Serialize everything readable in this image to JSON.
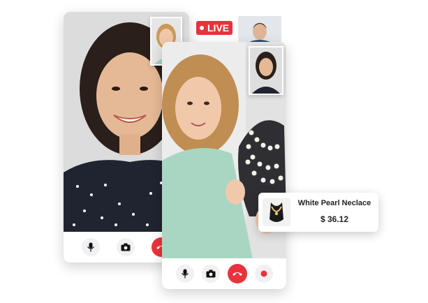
{
  "live_badge": {
    "label": "LIVE"
  },
  "product": {
    "name": "White Pearl Neclace",
    "price": "$ 36.12"
  },
  "colors": {
    "live_red": "#e8333d",
    "end_call_red": "#e8333d",
    "button_bg": "#f1f1f3"
  },
  "call_left": {
    "controls": [
      {
        "icon": "microphone-icon"
      },
      {
        "icon": "camera-icon"
      },
      {
        "icon": "end-call-icon"
      }
    ]
  },
  "call_right": {
    "controls": [
      {
        "icon": "microphone-icon"
      },
      {
        "icon": "camera-icon"
      },
      {
        "icon": "end-call-icon"
      },
      {
        "icon": "record-icon"
      }
    ]
  }
}
